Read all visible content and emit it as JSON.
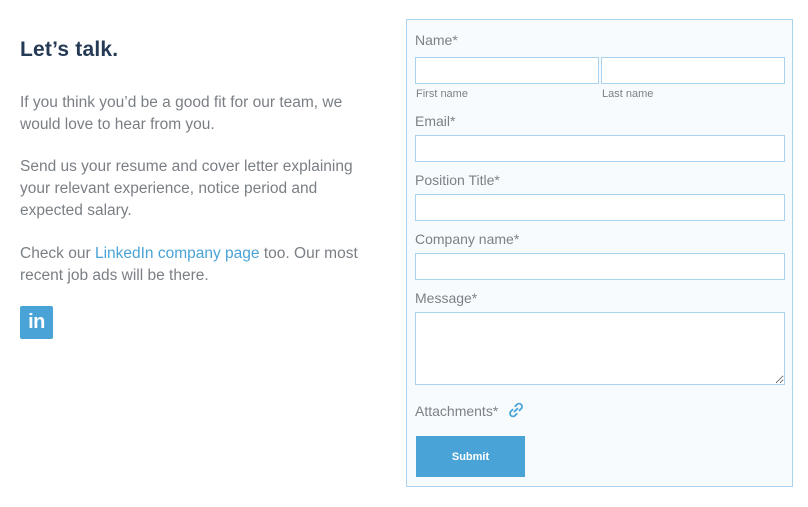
{
  "contact": {
    "heading": "Let’s talk.",
    "para1": "If you think you’d be a good fit for our team, we would love to hear from you.",
    "para2": "Send us your resume and cover letter explaining your relevant experience, notice period and expected salary.",
    "para3_before": "Check our ",
    "para3_link": "LinkedIn company page",
    "para3_after": " too.  Our most recent job ads will be there.",
    "linkedin_icon_text": "in"
  },
  "form": {
    "name_label": "Name*",
    "first_name_label": "First name",
    "last_name_label": "Last name",
    "email_label": "Email*",
    "position_label": "Position Title*",
    "company_label": "Company name*",
    "message_label": "Message*",
    "attachments_label": "Attachments*",
    "submit_label": "Submit"
  },
  "colors": {
    "accent": "#4aa3d6",
    "heading": "#243a55",
    "body_text": "#7a7f85",
    "form_border": "#a9d3ee"
  },
  "icons": {
    "linkedin": "linkedin-icon",
    "attachment": "paperclip-link-icon"
  }
}
